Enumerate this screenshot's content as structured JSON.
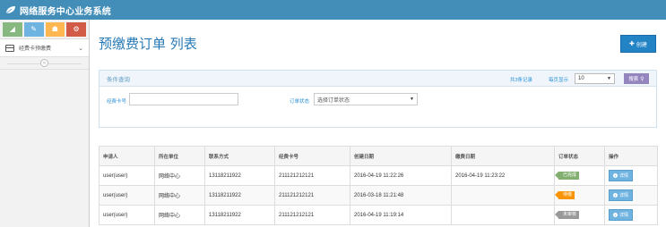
{
  "app": {
    "title": "网络服务中心业务系统"
  },
  "sidebar": {
    "shortcuts": [
      {
        "name": "signal-icon",
        "glyph": "◢",
        "color": "#87b87f"
      },
      {
        "name": "pencil-icon",
        "glyph": "✎",
        "color": "#6fb3e0"
      },
      {
        "name": "users-icon",
        "glyph": "☗",
        "color": "#ffb752"
      },
      {
        "name": "cogs-icon",
        "glyph": "⚙",
        "color": "#d15b47"
      }
    ],
    "items": [
      {
        "label": "经费卡预缴费"
      }
    ],
    "collapse_glyph": "«"
  },
  "main": {
    "title": "预缴费订单 列表",
    "create_label": "创建"
  },
  "query": {
    "title": "条件查询",
    "total_text": "共3条记录",
    "page_size_label": "每页显示",
    "page_size_value": "10",
    "search_label": "搜索",
    "card_label": "经费卡号",
    "card_value": "",
    "status_label": "订单状态",
    "status_value": "选择订单状态"
  },
  "table": {
    "headers": [
      "申请人",
      "所在单位",
      "联系方式",
      "经费卡号",
      "创建日期",
      "缴费日期",
      "订单状态",
      "操作"
    ],
    "detail_label": "详情",
    "rows": [
      {
        "applicant": "user(user)",
        "unit": "网络中心",
        "phone": "13118211922",
        "card": "211121212121",
        "created": "2016-04-19 11:22:26",
        "paid": "2016-04-19 11:23:22",
        "status": "已完成",
        "status_color": "#82af6f"
      },
      {
        "applicant": "user(user)",
        "unit": "网络中心",
        "phone": "13118211922",
        "card": "211121212121",
        "created": "2016-03-18 11:21:48",
        "paid": "",
        "status": "待缴",
        "status_color": "#f89406"
      },
      {
        "applicant": "user(user)",
        "unit": "网络中心",
        "phone": "13118211922",
        "card": "211121212121",
        "created": "2016-04-19 11:19:14",
        "paid": "",
        "status": "未审核",
        "status_color": "#999999"
      }
    ]
  }
}
